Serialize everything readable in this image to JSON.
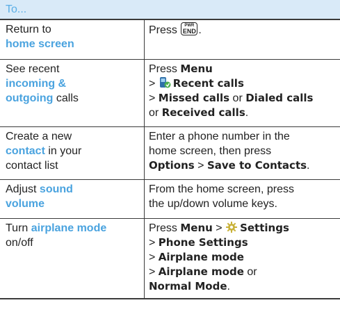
{
  "header": {
    "title": "To..."
  },
  "rows": [
    {
      "task_parts": [
        "Return to",
        "home screen"
      ],
      "how": {
        "pre": "Press",
        "key_top": "PWR",
        "key_bottom": "END",
        "post": "."
      }
    },
    {
      "task_parts": [
        "See recent",
        "incoming &",
        "outgoing",
        "calls"
      ],
      "how": {
        "l1a": "Press",
        "l1b": "Menu",
        "l2a": ">",
        "l2b": "Recent calls",
        "l3a": ">",
        "l3b": "Missed calls",
        "l3c": "or",
        "l3d": "Dialed calls",
        "l4a": "or",
        "l4b": "Received calls",
        "l4c": "."
      }
    },
    {
      "task_parts": [
        "Create a new",
        "contact",
        "in your",
        "contact list"
      ],
      "how": {
        "l1": "Enter a phone number in the",
        "l2": "home screen, then press",
        "l3a": "Options",
        "l3b": ">",
        "l3c": "Save to Contacts",
        "l3d": "."
      }
    },
    {
      "task_parts": [
        "Adjust",
        "sound",
        "volume"
      ],
      "how": {
        "l1": "From the home screen, press",
        "l2": "the up/down volume keys."
      }
    },
    {
      "task_parts": [
        "Turn",
        "airplane mode",
        "on/off"
      ],
      "how": {
        "l1a": "Press",
        "l1b": "Menu",
        "l1c": ">",
        "l1d": "Settings",
        "l2a": ">",
        "l2b": "Phone Settings",
        "l3a": ">",
        "l3b": "Airplane mode",
        "l4a": ">",
        "l4b": "Airplane mode",
        "l4c": "or",
        "l5a": "Normal Mode",
        "l5b": "."
      }
    }
  ]
}
